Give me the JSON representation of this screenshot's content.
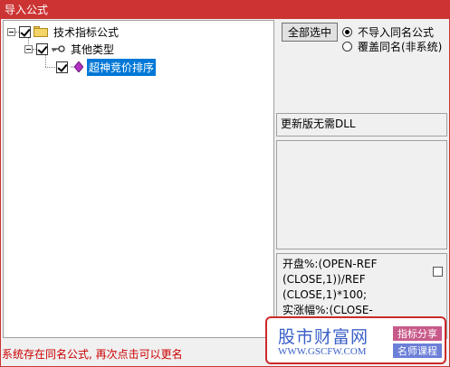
{
  "window": {
    "title": "导入公式"
  },
  "tree": {
    "root": {
      "label": "技术指标公式",
      "checked": true,
      "icon": "folder-icon"
    },
    "child": {
      "label": "其他类型",
      "checked": true,
      "icon": "key-icon"
    },
    "leaf": {
      "label": "超神竞价排序",
      "checked": true,
      "icon": "diamond-icon",
      "selected": true
    }
  },
  "options": {
    "select_all_label": "全部选中",
    "radio_skip_label": "不导入同名公式",
    "radio_overwrite_label": "覆盖同名(非系统)",
    "selected": "skip"
  },
  "note": {
    "text": "更新版无需DLL"
  },
  "code": {
    "lines": [
      "开盘%:(OPEN-REF",
      "(CLOSE,1))/REF",
      "(CLOSE,1)*100;",
      "实涨幅%:(CLOSE-"
    ]
  },
  "status": {
    "text": "系统存在同名公式, 再次点击可以更名"
  },
  "watermark": {
    "name": "股市财富网",
    "url": "WWW.GSCFW.COM",
    "tag1": "指标分享",
    "tag2": "名师课程"
  },
  "colors": {
    "title_bar": "#cc3333",
    "selection": "#0078d7",
    "status_text": "#cc0000"
  }
}
